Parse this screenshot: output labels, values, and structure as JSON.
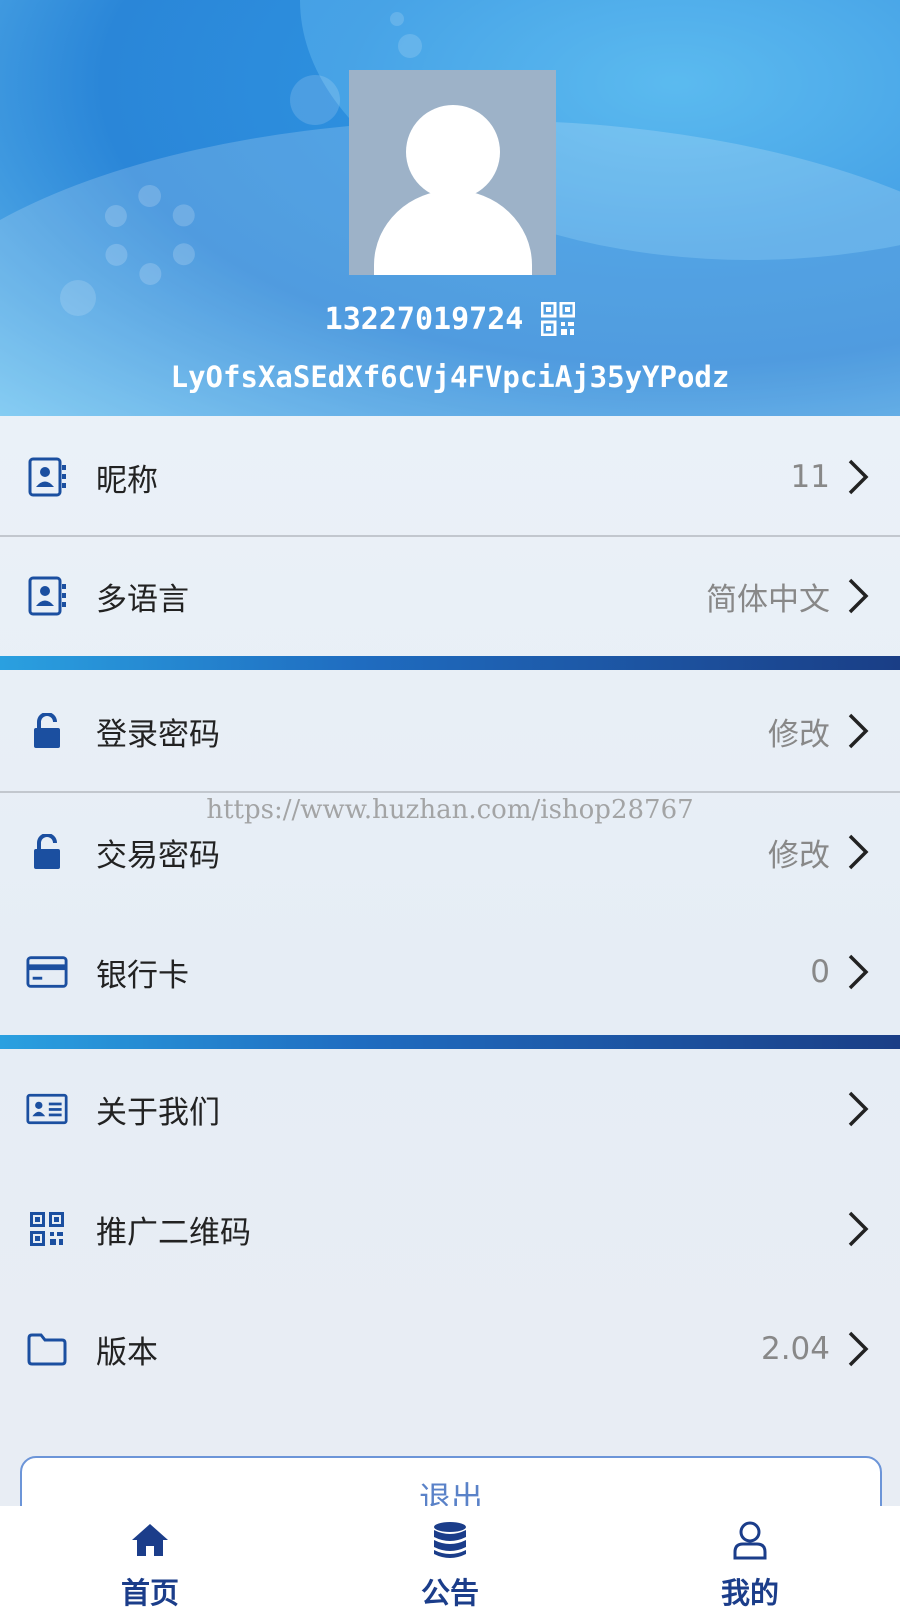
{
  "profile": {
    "phone": "13227019724",
    "address": "LyOfsXaSEdXf6CVj4FVpciAj35yYPodz"
  },
  "menu": {
    "nickname": {
      "label": "昵称",
      "value": "11"
    },
    "language": {
      "label": "多语言",
      "value": "简体中文"
    },
    "login_password": {
      "label": "登录密码",
      "value": "修改"
    },
    "trade_password": {
      "label": "交易密码",
      "value": "修改"
    },
    "bank_card": {
      "label": "银行卡",
      "value": "0"
    },
    "about": {
      "label": "关于我们",
      "value": ""
    },
    "promo_qr": {
      "label": "推广二维码",
      "value": ""
    },
    "version": {
      "label": "版本",
      "value": "2.04"
    }
  },
  "watermark": "https://www.huzhan.com/ishop28767",
  "logout_label": "退出",
  "tabs": [
    {
      "label": "首页",
      "icon": "home-icon"
    },
    {
      "label": "公告",
      "icon": "database-icon"
    },
    {
      "label": "我的",
      "icon": "user-icon"
    }
  ],
  "colors": {
    "header_blue": "#2d8fde",
    "icon_blue": "#1b4fa0",
    "tab_navy": "#1b3d8a"
  }
}
